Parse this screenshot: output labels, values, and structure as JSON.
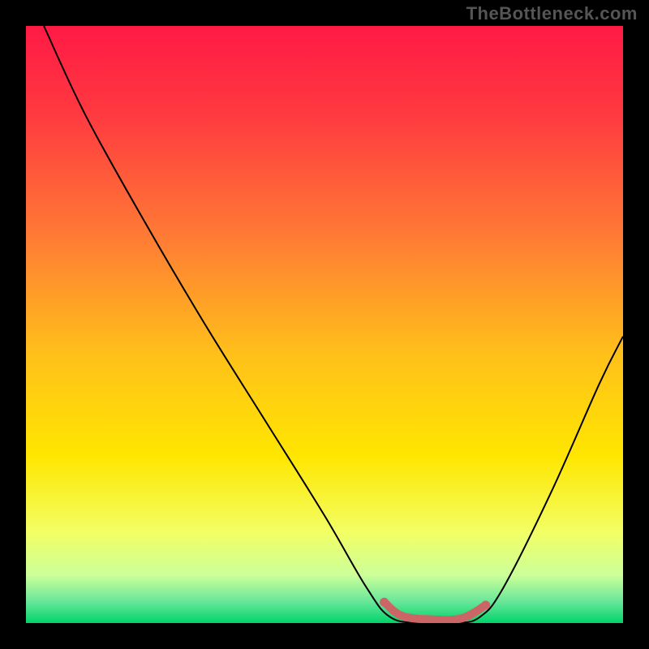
{
  "watermark": "TheBottleneck.com",
  "chart_data": {
    "type": "line",
    "title": "",
    "xlabel": "",
    "ylabel": "",
    "xlim": [
      0,
      100
    ],
    "ylim": [
      0,
      100
    ],
    "background_gradient": {
      "direction": "vertical",
      "stops": [
        {
          "pos": 0.0,
          "color": "#ff1a44"
        },
        {
          "pos": 0.15,
          "color": "#ff3a40"
        },
        {
          "pos": 0.35,
          "color": "#ff7a35"
        },
        {
          "pos": 0.55,
          "color": "#ffc01a"
        },
        {
          "pos": 0.72,
          "color": "#ffe600"
        },
        {
          "pos": 0.85,
          "color": "#f2ff66"
        },
        {
          "pos": 0.92,
          "color": "#ccff99"
        },
        {
          "pos": 0.965,
          "color": "#66e699"
        },
        {
          "pos": 1.0,
          "color": "#00d46a"
        }
      ]
    },
    "series": [
      {
        "name": "bottleneck-curve",
        "stroke": "#000000",
        "stroke_width": 2,
        "points": [
          {
            "x": 3,
            "y": 100
          },
          {
            "x": 10,
            "y": 85
          },
          {
            "x": 20,
            "y": 67
          },
          {
            "x": 30,
            "y": 50
          },
          {
            "x": 40,
            "y": 34
          },
          {
            "x": 50,
            "y": 18
          },
          {
            "x": 57,
            "y": 6
          },
          {
            "x": 61,
            "y": 1
          },
          {
            "x": 66,
            "y": 0
          },
          {
            "x": 72,
            "y": 0
          },
          {
            "x": 76,
            "y": 1
          },
          {
            "x": 80,
            "y": 6
          },
          {
            "x": 88,
            "y": 22
          },
          {
            "x": 96,
            "y": 40
          },
          {
            "x": 100,
            "y": 48
          }
        ]
      }
    ],
    "highlight_band": {
      "name": "optimal-range",
      "color": "#cc6666",
      "thickness": 10,
      "points": [
        {
          "x": 60,
          "y": 3.5
        },
        {
          "x": 63,
          "y": 1.2
        },
        {
          "x": 68,
          "y": 0.6
        },
        {
          "x": 73,
          "y": 0.8
        },
        {
          "x": 77,
          "y": 3.0
        }
      ],
      "endcaps": [
        {
          "x": 60,
          "y": 3.5
        },
        {
          "x": 77,
          "y": 3.0
        }
      ]
    }
  }
}
